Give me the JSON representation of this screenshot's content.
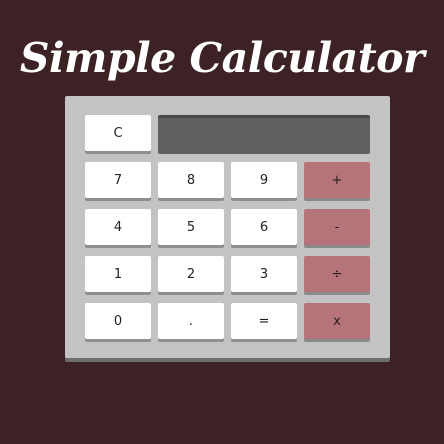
{
  "title": "Simple Calculator",
  "display": {
    "value": ""
  },
  "keys": {
    "clear": "C",
    "seven": "7",
    "eight": "8",
    "nine": "9",
    "plus": "+",
    "four": "4",
    "five": "5",
    "six": "6",
    "minus": "-",
    "one": "1",
    "two": "2",
    "three": "3",
    "divide": "÷",
    "zero": "0",
    "decimal": ".",
    "equals": "=",
    "multiply": "x"
  },
  "colors": {
    "background": "#3c2224",
    "calculator_body": "#c3c3c3",
    "display": "#606060",
    "number_key": "#ffffff",
    "operator_key": "#b57479"
  }
}
